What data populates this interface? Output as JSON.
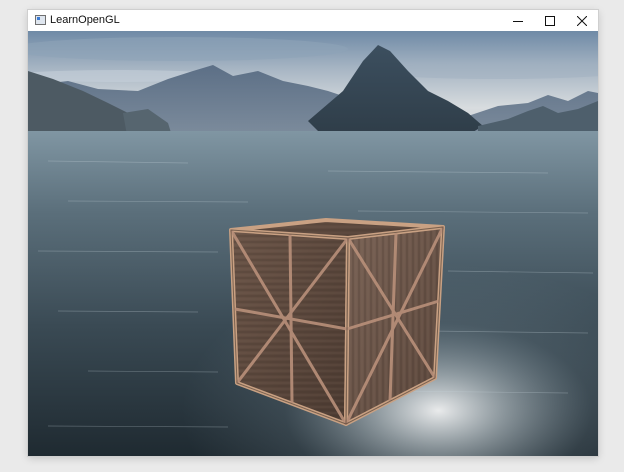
{
  "window": {
    "title": "LearnOpenGL",
    "icon": "opengl-window-icon",
    "controls": [
      "minimize-icon",
      "maximize-icon",
      "close-icon"
    ]
  },
  "scene": {
    "description_colors": {
      "sky_top": "#6d8aa8",
      "sky_horizon": "#d9dde0",
      "water_dark": "#2c3a43",
      "water_light": "#9fb2bd",
      "crate_wood": "#6b5548",
      "crate_edge": "#c9a183"
    }
  }
}
